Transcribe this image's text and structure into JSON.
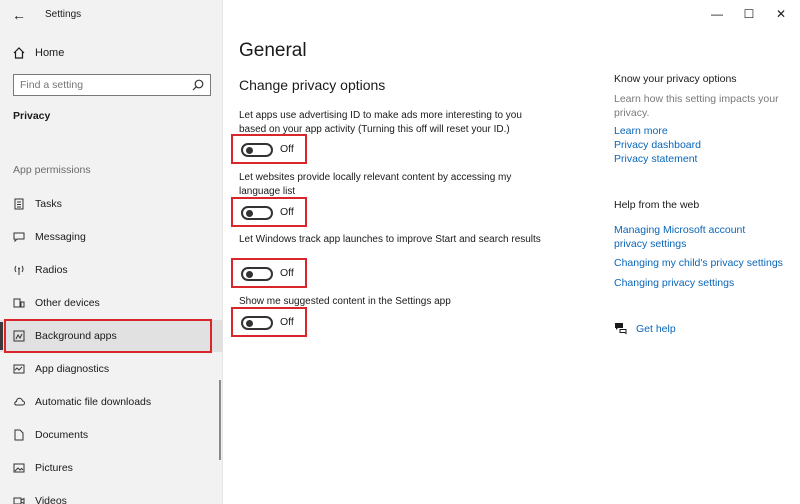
{
  "window": {
    "title": "Settings",
    "controls": {
      "minimize": "—",
      "maximize": "☐",
      "close": "✕"
    }
  },
  "sidebar": {
    "home_label": "Home",
    "search": {
      "placeholder": "Find a setting"
    },
    "section_title": "Privacy",
    "group_title": "App permissions",
    "items": [
      {
        "label": "Tasks",
        "icon": "tasks-icon"
      },
      {
        "label": "Messaging",
        "icon": "messaging-icon"
      },
      {
        "label": "Radios",
        "icon": "radios-icon"
      },
      {
        "label": "Other devices",
        "icon": "other-devices-icon"
      },
      {
        "label": "Background apps",
        "icon": "background-apps-icon",
        "selected": true
      },
      {
        "label": "App diagnostics",
        "icon": "app-diagnostics-icon"
      },
      {
        "label": "Automatic file downloads",
        "icon": "cloud-icon"
      },
      {
        "label": "Documents",
        "icon": "documents-icon"
      },
      {
        "label": "Pictures",
        "icon": "pictures-icon"
      },
      {
        "label": "Videos",
        "icon": "videos-icon"
      }
    ]
  },
  "main": {
    "title": "General",
    "subheader": "Change privacy options",
    "options": [
      {
        "text": "Let apps use advertising ID to make ads more interesting to you based on your app activity (Turning this off will reset your ID.)",
        "state": "Off"
      },
      {
        "text": "Let websites provide locally relevant content by accessing my language list",
        "state": "Off"
      },
      {
        "text": "Let Windows track app launches to improve Start and search results",
        "state": "Off"
      },
      {
        "text": "Show me suggested content in the Settings app",
        "state": "Off"
      }
    ]
  },
  "right": {
    "know_title": "Know your privacy options",
    "know_desc": "Learn how this setting impacts your privacy.",
    "know_links": [
      "Learn more",
      "Privacy dashboard",
      "Privacy statement"
    ],
    "help_title": "Help from the web",
    "help_links": [
      "Managing Microsoft account privacy settings",
      "Changing my child's privacy settings",
      "Changing privacy settings"
    ],
    "get_help": "Get help"
  },
  "colors": {
    "highlight_border": "#d9262c",
    "link": "#0a66b8",
    "sidebar_bg": "#f2f2f2"
  }
}
